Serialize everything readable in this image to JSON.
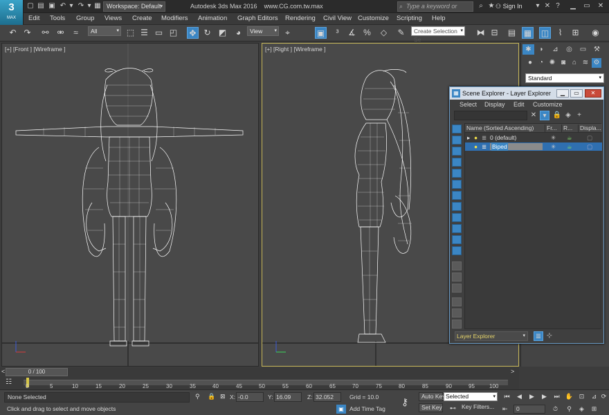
{
  "titlebar": {
    "logo_text": "3",
    "logo_sub": "MAX",
    "workspace": "Workspace: Default",
    "title": "Autodesk 3ds Max 2016",
    "filename": "www.CG.com.tw.max",
    "search_placeholder": "Type a keyword or phrase",
    "sign_in": "Sign In"
  },
  "menu": [
    "Edit",
    "Tools",
    "Group",
    "Views",
    "Create",
    "Modifiers",
    "Animation",
    "Graph Editors",
    "Rendering",
    "Civil View",
    "Customize",
    "Scripting",
    "Help"
  ],
  "toolbar": {
    "selection_filter": "All",
    "ref_coord": "View",
    "named_selection": "Create Selection Se"
  },
  "viewports": {
    "front_label": "[+] [Front ] [Wireframe ]",
    "right_label": "[+] [Right ] [Wireframe ]"
  },
  "command_panel": {
    "object_type": "Standard"
  },
  "scene_explorer": {
    "title": "Scene Explorer - Layer Explorer",
    "menu": [
      "Select",
      "Display",
      "Edit",
      "Customize"
    ],
    "columns": [
      "Name (Sorted Ascending)",
      "Fr...",
      "R...",
      "Displa..."
    ],
    "rows": [
      {
        "name": "0 (default)",
        "selected": false
      },
      {
        "name": "Biped",
        "selected": true
      }
    ],
    "mode": "Layer Explorer"
  },
  "timeline": {
    "position": "0 / 100",
    "ticks": [
      "0",
      "5",
      "10",
      "15",
      "20",
      "25",
      "30",
      "35",
      "40",
      "45",
      "50",
      "55",
      "60",
      "65",
      "70",
      "75",
      "80",
      "85",
      "90",
      "95",
      "100"
    ]
  },
  "status": {
    "selection": "None Selected",
    "prompt": "Click and drag to select and move objects",
    "x_label": "X:",
    "x_value": "-0.0",
    "y_label": "Y:",
    "y_value": "16.09",
    "z_label": "Z:",
    "z_value": "32.052",
    "grid": "Grid = 10.0",
    "add_time_tag": "Add Time Tag",
    "auto_key": "Auto Key",
    "set_key": "Set Key",
    "key_mode": "Selected",
    "key_filters": "Key Filters...",
    "frame": "0"
  },
  "colors": {
    "accent": "#3b86c4",
    "active_viewport_border": "#c8b85a",
    "wireframe": "#ffffff",
    "viewport_bg": "#494949"
  }
}
